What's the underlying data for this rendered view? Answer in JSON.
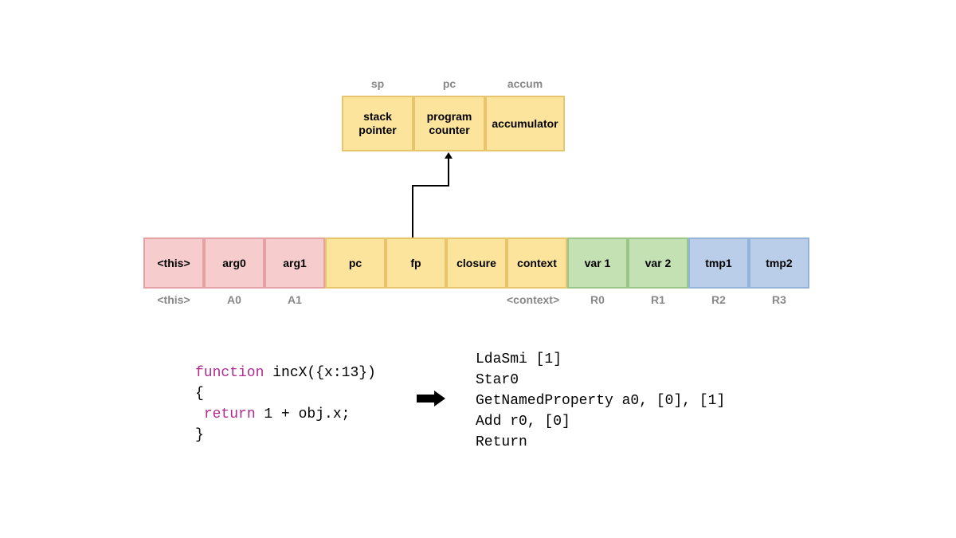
{
  "top_labels": {
    "sp": "sp",
    "pc": "pc",
    "accum": "accum"
  },
  "top_cells": {
    "stack_pointer": "stack\npointer",
    "program_counter": "program\ncounter",
    "accumulator": "accumulator"
  },
  "frame_cells": {
    "this": "<this>",
    "arg0": "arg0",
    "arg1": "arg1",
    "pc": "pc",
    "fp": "fp",
    "closure": "closure",
    "context": "context",
    "var1": "var 1",
    "var2": "var 2",
    "tmp1": "tmp1",
    "tmp2": "tmp2"
  },
  "frame_labels": {
    "this": "<this>",
    "a0": "A0",
    "a1": "A1",
    "context": "<context>",
    "r0": "R0",
    "r1": "R1",
    "r2": "R2",
    "r3": "R3"
  },
  "code": {
    "kw_function": "function",
    "fn_rest": " incX({x:13})",
    "brace_open": "{",
    "kw_return": "return",
    "ret_rest": " 1 + obj.x;",
    "brace_close": "}",
    "bytecode": "LdaSmi [1]\nStar0\nGetNamedProperty a0, [0], [1]\nAdd r0, [0]\nReturn"
  }
}
